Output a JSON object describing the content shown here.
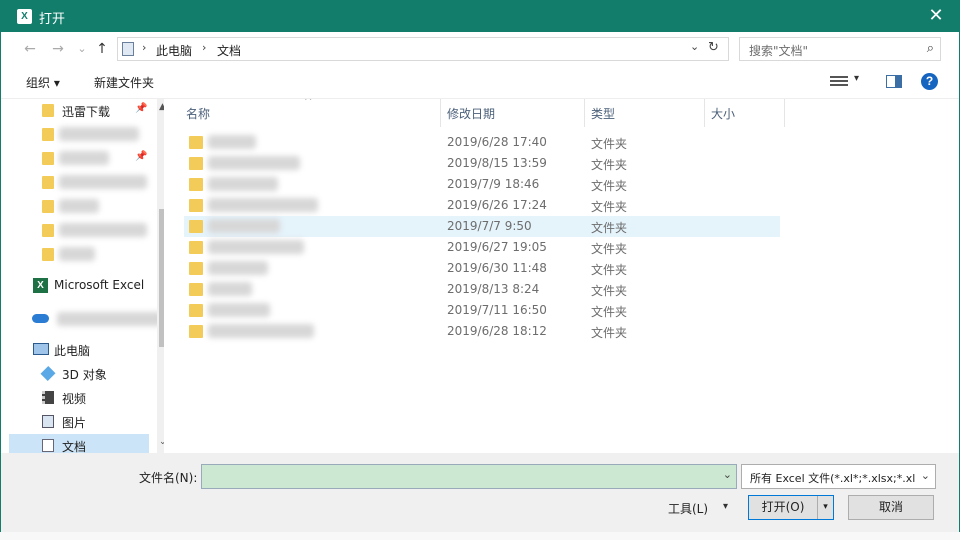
{
  "window": {
    "title": "打开",
    "app_icon_letter": "X",
    "close_glyph": "✕"
  },
  "nav": {
    "back_glyph": "←",
    "forward_glyph": "→",
    "recent_glyph": "⌄",
    "up_glyph": "↑",
    "crumbs": [
      "此电脑",
      "文档"
    ],
    "crumb_sep": "›",
    "dropdown_glyph": "⌄",
    "refresh_glyph": "↻",
    "search_placeholder": "搜索\"文档\"",
    "search_glyph": "⌕"
  },
  "toolbar": {
    "organize": "组织 ▾",
    "new_folder": "新建文件夹",
    "view_dd": "▾",
    "help": "?"
  },
  "sidebar": {
    "items": [
      {
        "label": "迅雷下载"
      },
      {
        "label": "Microsoft Excel"
      },
      {
        "label": "此电脑"
      },
      {
        "label": "3D 对象"
      },
      {
        "label": "视频"
      },
      {
        "label": "图片"
      },
      {
        "label": "文档"
      }
    ],
    "pin_glyph": "📌",
    "scroll_up": "▲",
    "scroll_down": "⌄"
  },
  "columns": {
    "name": "名称",
    "modified": "修改日期",
    "type": "类型",
    "size": "大小",
    "sort_caret": "^"
  },
  "files": [
    {
      "date": "2019/6/28 17:40",
      "type": "文件夹"
    },
    {
      "date": "2019/8/15 13:59",
      "type": "文件夹"
    },
    {
      "date": "2019/7/9 18:46",
      "type": "文件夹"
    },
    {
      "date": "2019/6/26 17:24",
      "type": "文件夹"
    },
    {
      "date": "2019/7/7 9:50",
      "type": "文件夹"
    },
    {
      "date": "2019/6/27 19:05",
      "type": "文件夹"
    },
    {
      "date": "2019/6/30 11:48",
      "type": "文件夹"
    },
    {
      "date": "2019/8/13 8:24",
      "type": "文件夹"
    },
    {
      "date": "2019/7/11 16:50",
      "type": "文件夹"
    },
    {
      "date": "2019/6/28 18:12",
      "type": "文件夹"
    }
  ],
  "bottom": {
    "filename_label": "文件名(N):",
    "filename_value": "",
    "filter_text": "所有 Excel 文件(*.xl*;*.xlsx;*.xl",
    "tools": "工具(L)",
    "tools_dd": "▾",
    "open": "打开(O)",
    "open_split": "▾",
    "cancel": "取消"
  },
  "colors": {
    "titlebar": "#137d6c",
    "filename_field": "#cde8d2",
    "selection": "#cce4f7",
    "hover_row": "#e5f3fb",
    "folder": "#f3cb58"
  }
}
